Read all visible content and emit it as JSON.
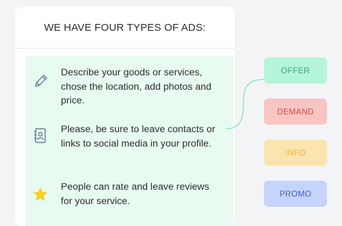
{
  "panel": {
    "title": "WE HAVE FOUR TYPES OF ADS:"
  },
  "features": [
    {
      "icon": "pencil-icon",
      "text": "Describe your goods or services, chose the location, add photos and price."
    },
    {
      "icon": "contact-card-icon",
      "text": "Please, be sure to leave contacts or links to social media in your profile."
    },
    {
      "icon": "star-icon",
      "text": "People can rate and leave reviews for your service."
    }
  ],
  "tags": [
    {
      "label": "OFFER",
      "color": "#2ea876",
      "bg": "#b3f5d8"
    },
    {
      "label": "DEMAND",
      "color": "#e04a45",
      "bg": "#f7c5c2"
    },
    {
      "label": "INFO",
      "color": "#f4b62f",
      "bg": "#fce4ae"
    },
    {
      "label": "PROMO",
      "color": "#4460d0",
      "bg": "#c6d3fb"
    }
  ],
  "colors": {
    "feature_background": "#e7fbf1",
    "icon_stroke": "#6b7f99",
    "star": "#f9d01e",
    "connector": "#7ee0b3"
  }
}
